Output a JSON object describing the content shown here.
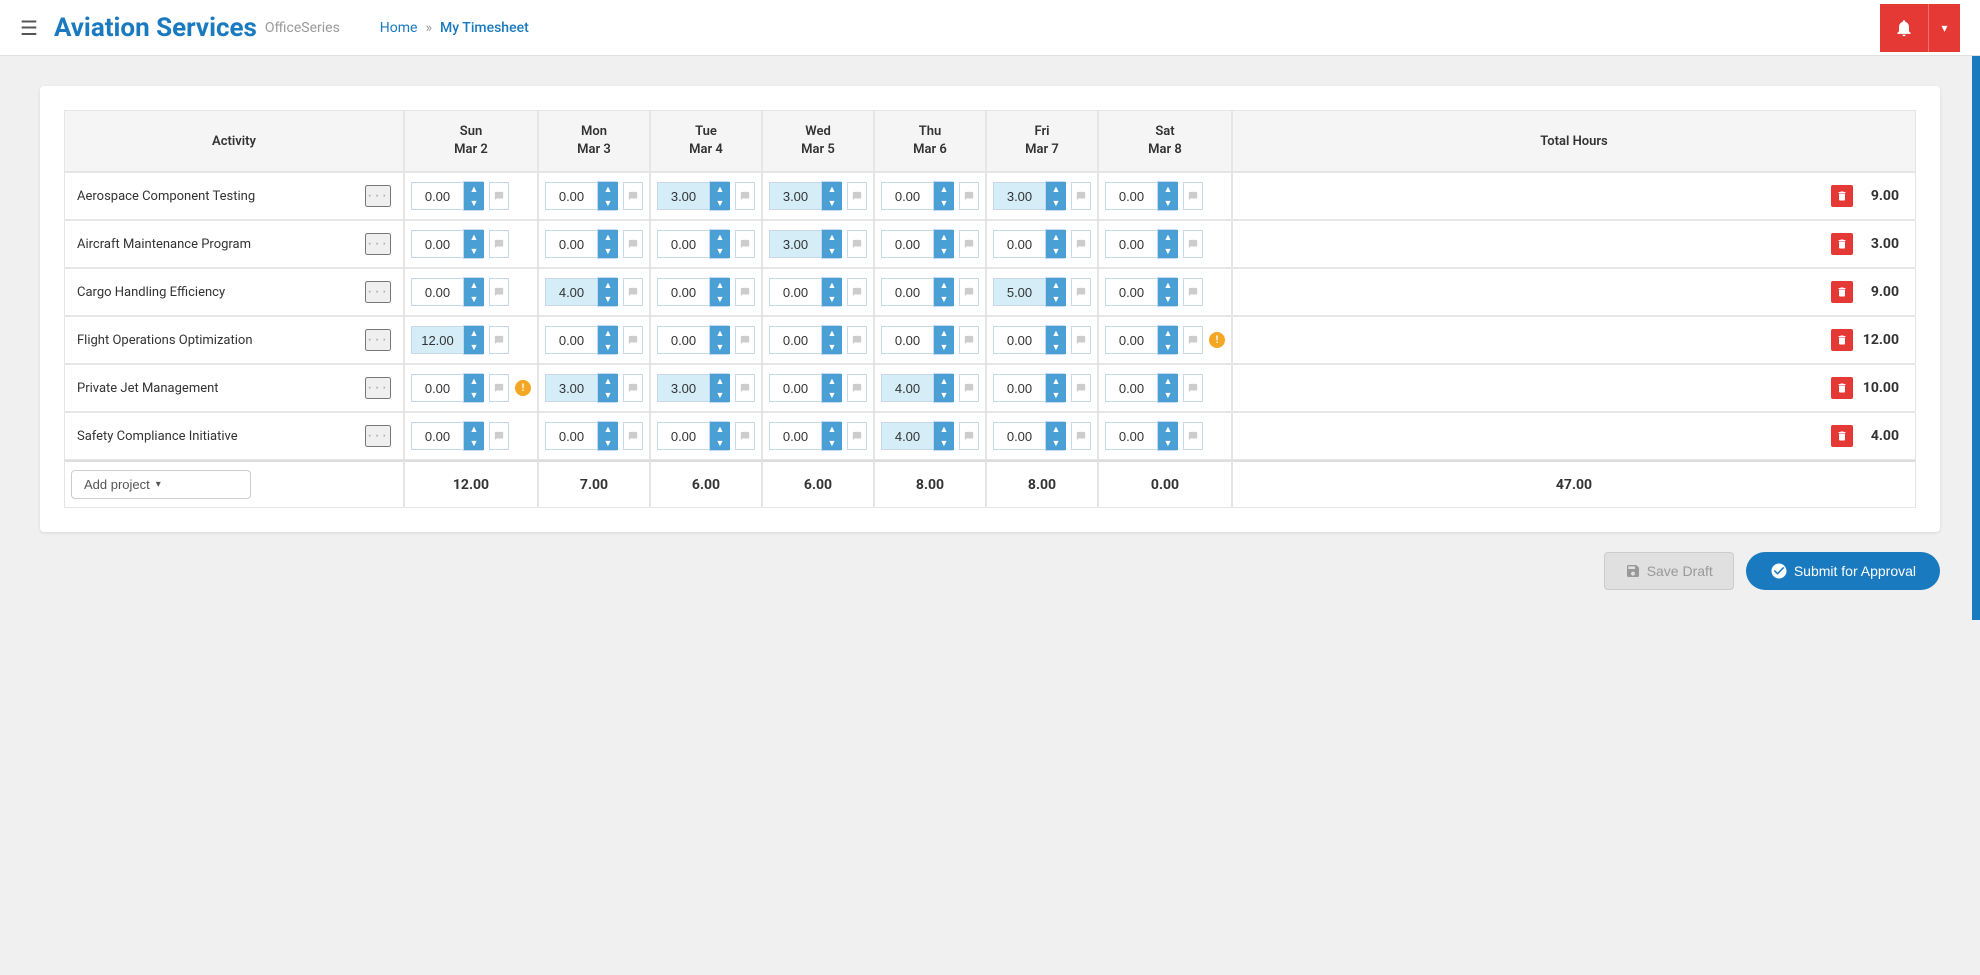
{
  "header": {
    "menu_icon": "☰",
    "title": "Aviation Services",
    "subtitle": "OfficeSeries",
    "nav_home": "Home",
    "nav_sep": "»",
    "nav_current": "My Timesheet",
    "bell_icon": "🔔",
    "dropdown_icon": "▾"
  },
  "table": {
    "col_activity": "Activity",
    "col_sun": "Sun\nMar 2",
    "col_sun_line1": "Sun",
    "col_sun_line2": "Mar 2",
    "col_mon_line1": "Mon",
    "col_mon_line2": "Mar 3",
    "col_tue_line1": "Tue",
    "col_tue_line2": "Mar 4",
    "col_wed_line1": "Wed",
    "col_wed_line2": "Mar 5",
    "col_thu_line1": "Thu",
    "col_thu_line2": "Mar 6",
    "col_fri_line1": "Fri",
    "col_fri_line2": "Mar 7",
    "col_sat_line1": "Sat",
    "col_sat_line2": "Mar 8",
    "col_total": "Total Hours",
    "rows": [
      {
        "name": "Aerospace Component Testing",
        "values": [
          "0.00",
          "0.00",
          "3.00",
          "3.00",
          "0.00",
          "3.00",
          "0.00"
        ],
        "highlights": [
          false,
          false,
          true,
          true,
          false,
          true,
          false
        ],
        "total": "9.00",
        "warnings": [
          false,
          false,
          false,
          false,
          false,
          false,
          false
        ]
      },
      {
        "name": "Aircraft Maintenance Program",
        "values": [
          "0.00",
          "0.00",
          "0.00",
          "3.00",
          "0.00",
          "0.00",
          "0.00"
        ],
        "highlights": [
          false,
          false,
          false,
          true,
          false,
          false,
          false
        ],
        "total": "3.00",
        "warnings": [
          false,
          false,
          false,
          false,
          false,
          false,
          false
        ]
      },
      {
        "name": "Cargo Handling Efficiency",
        "values": [
          "0.00",
          "4.00",
          "0.00",
          "0.00",
          "0.00",
          "5.00",
          "0.00"
        ],
        "highlights": [
          false,
          true,
          false,
          false,
          false,
          true,
          false
        ],
        "total": "9.00",
        "warnings": [
          false,
          false,
          false,
          false,
          false,
          false,
          false
        ]
      },
      {
        "name": "Flight Operations Optimization",
        "values": [
          "12.00",
          "0.00",
          "0.00",
          "0.00",
          "0.00",
          "0.00",
          "0.00"
        ],
        "highlights": [
          true,
          false,
          false,
          false,
          false,
          false,
          false
        ],
        "total": "12.00",
        "warnings": [
          false,
          false,
          false,
          false,
          false,
          false,
          true
        ]
      },
      {
        "name": "Private Jet Management",
        "values": [
          "0.00",
          "3.00",
          "3.00",
          "0.00",
          "4.00",
          "0.00",
          "0.00"
        ],
        "highlights": [
          false,
          true,
          true,
          false,
          true,
          false,
          false
        ],
        "total": "10.00",
        "warnings": [
          true,
          false,
          false,
          false,
          false,
          false,
          false
        ]
      },
      {
        "name": "Safety Compliance Initiative",
        "values": [
          "0.00",
          "0.00",
          "0.00",
          "0.00",
          "4.00",
          "0.00",
          "0.00"
        ],
        "highlights": [
          false,
          false,
          false,
          false,
          true,
          false,
          false
        ],
        "total": "4.00",
        "warnings": [
          false,
          false,
          false,
          false,
          false,
          false,
          false
        ]
      }
    ],
    "footer_totals": [
      "12.00",
      "7.00",
      "6.00",
      "6.00",
      "8.00",
      "8.00",
      "0.00"
    ],
    "footer_grand_total": "47.00",
    "add_project_label": "Add project",
    "save_draft_label": "Save Draft",
    "submit_label": "Submit for Approval"
  }
}
